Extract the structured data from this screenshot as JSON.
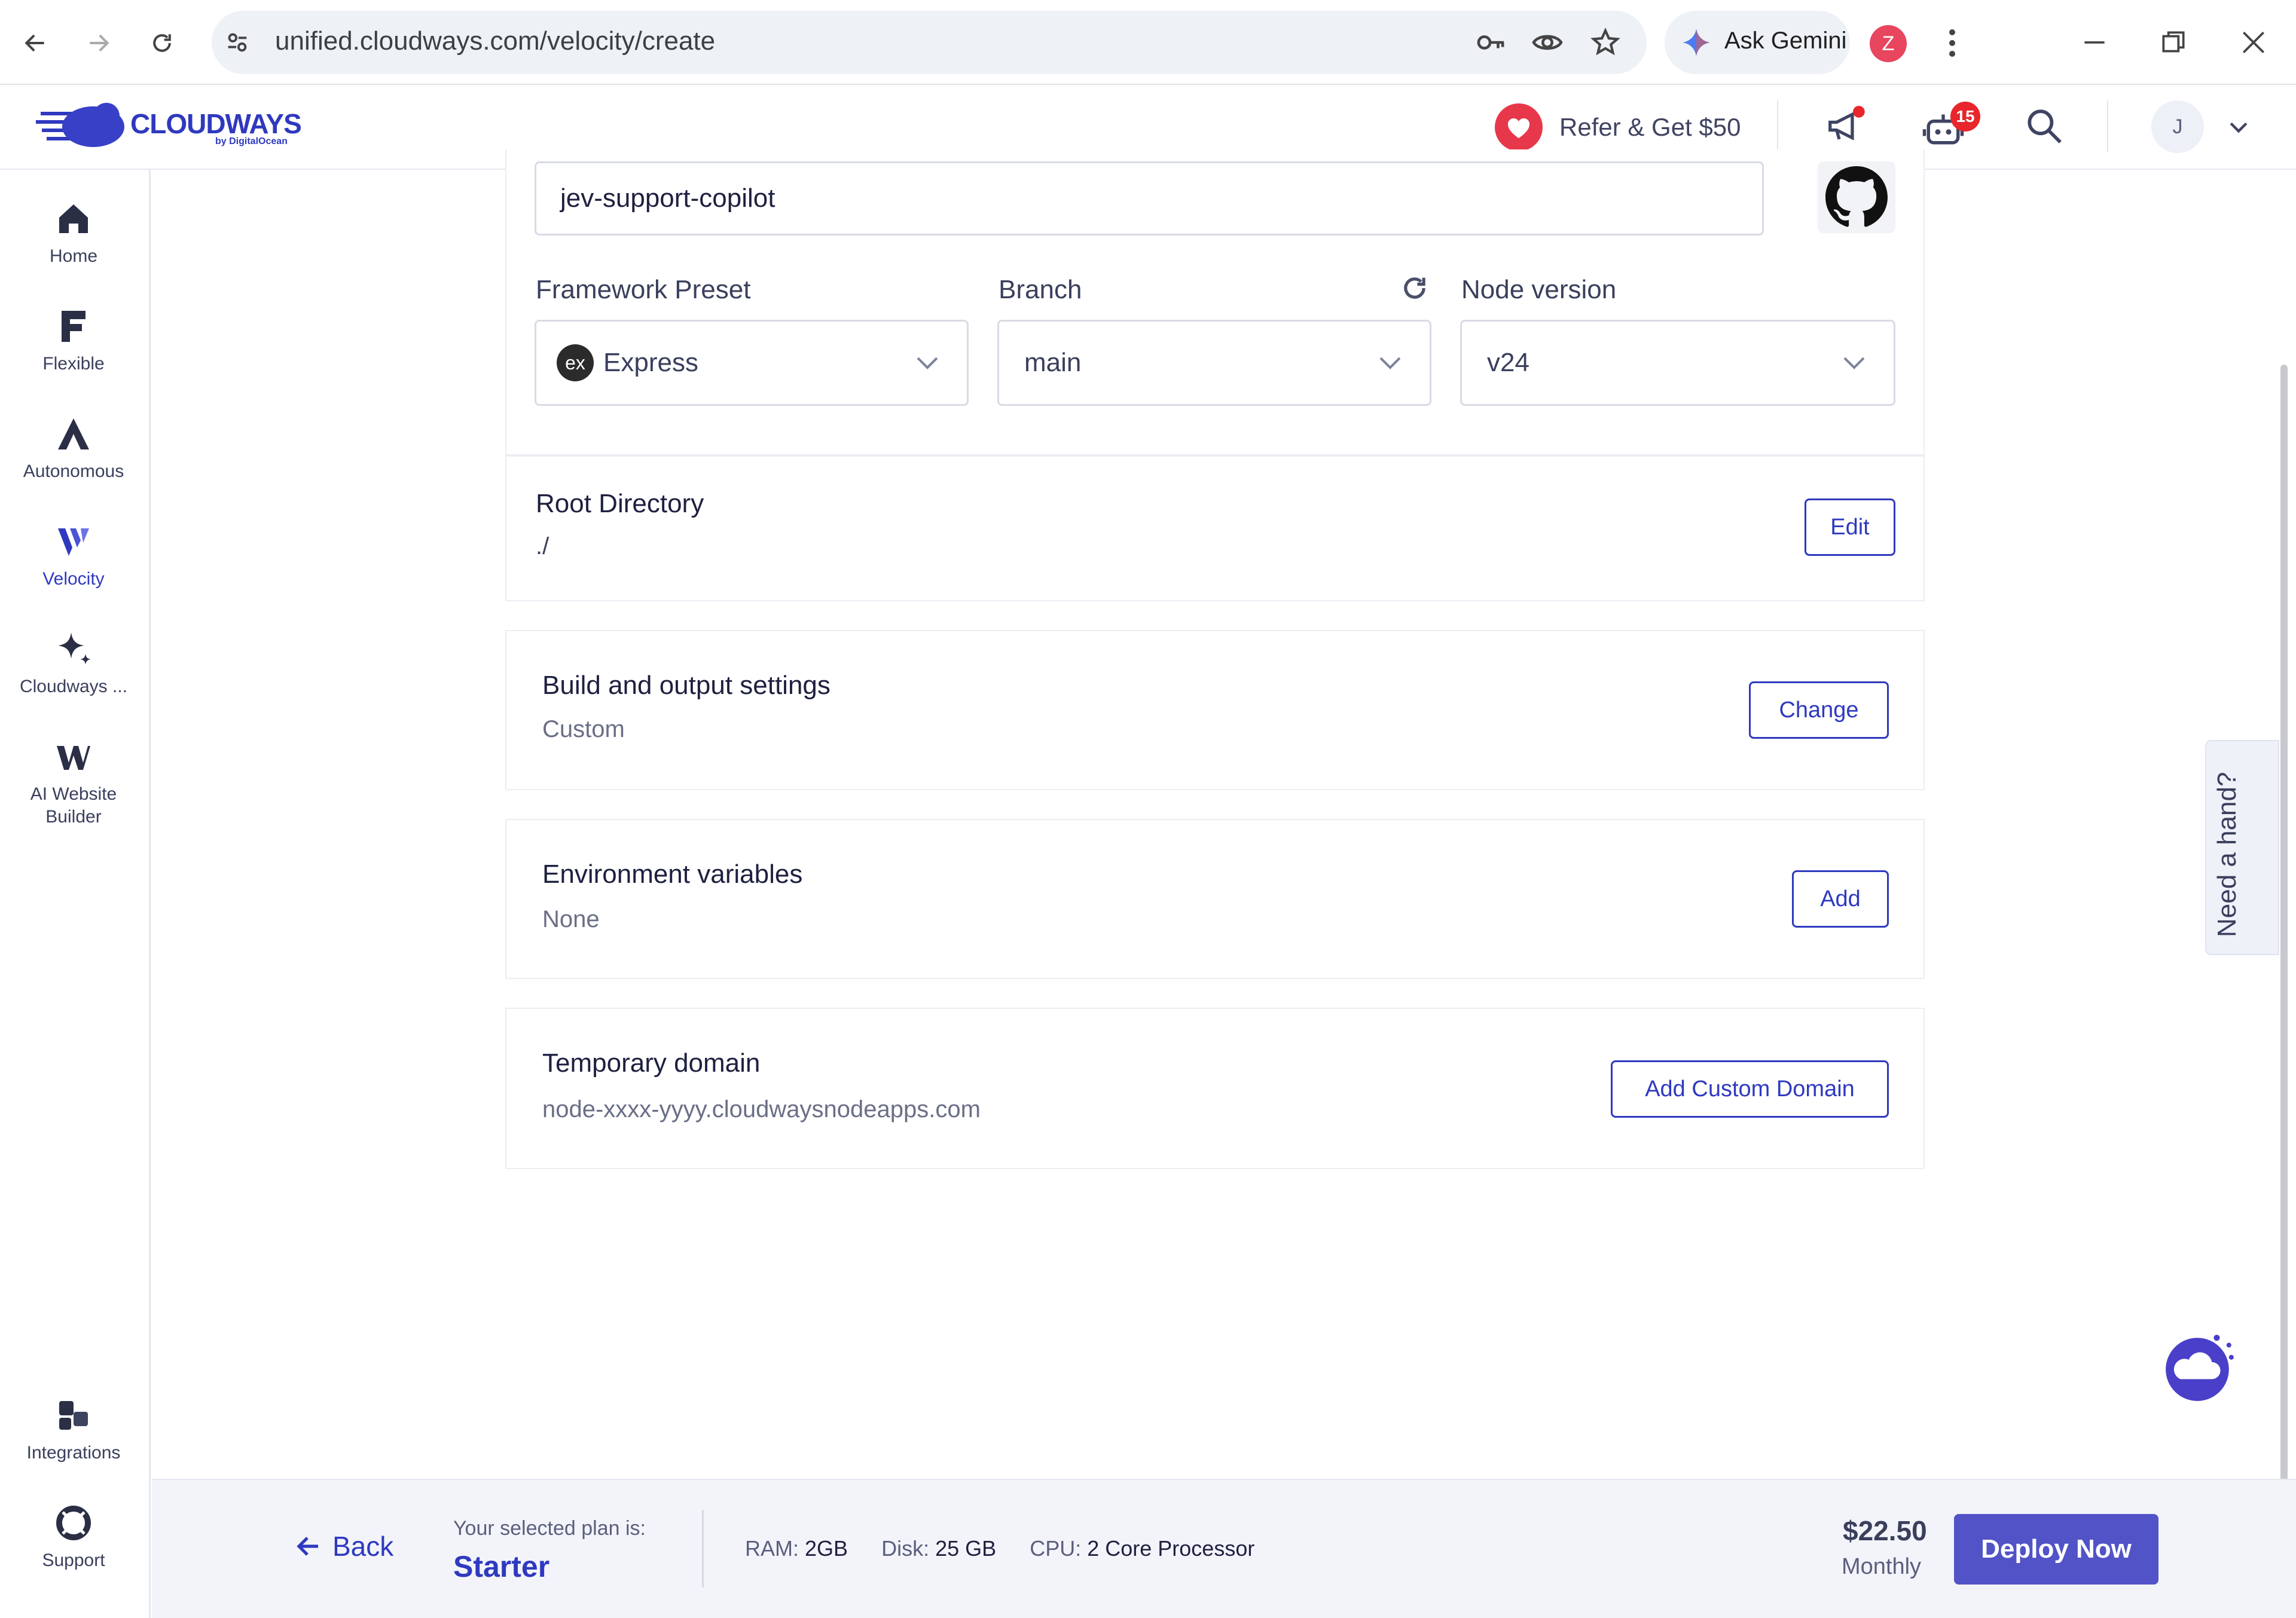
{
  "browser": {
    "url": "unified.cloudways.com/velocity/create",
    "ask_gemini": "Ask Gemini",
    "profile_initial": "Z"
  },
  "header": {
    "logo_text": "CLOUDWAYS",
    "logo_sub": "by DigitalOcean",
    "refer_label": "Refer & Get $50",
    "bot_badge": "15",
    "avatar_initial": "J"
  },
  "sidebar": {
    "items": [
      {
        "label": "Home",
        "icon": "home-icon"
      },
      {
        "label": "Flexible",
        "icon": "flexible-icon"
      },
      {
        "label": "Autonomous",
        "icon": "autonomous-icon"
      },
      {
        "label": "Velocity",
        "icon": "velocity-icon"
      },
      {
        "label": "Cloudways ...",
        "icon": "sparkle-icon"
      },
      {
        "label": "AI Website Builder",
        "icon": "ai-builder-icon"
      }
    ],
    "bottom_items": [
      {
        "label": "Integrations",
        "icon": "integrations-icon"
      },
      {
        "label": "Support",
        "icon": "support-icon"
      }
    ]
  },
  "form": {
    "repo_value": "jev-support-copilot",
    "framework": {
      "label": "Framework Preset",
      "value": "Express",
      "badge": "ex"
    },
    "branch": {
      "label": "Branch",
      "value": "main"
    },
    "node_version": {
      "label": "Node version",
      "value": "v24"
    },
    "root_directory": {
      "title": "Root Directory",
      "value": "./",
      "button": "Edit"
    },
    "build": {
      "title": "Build and output settings",
      "value": "Custom",
      "button": "Change"
    },
    "env": {
      "title": "Environment variables",
      "value": "None",
      "button": "Add"
    },
    "domain": {
      "title": "Temporary domain",
      "value": "node-xxxx-yyyy.cloudwaysnodeapps.com",
      "button": "Add Custom Domain"
    }
  },
  "footer": {
    "back_label": "Back",
    "plan_caption": "Your selected plan is:",
    "plan_name": "Starter",
    "ram_label": "RAM:",
    "ram_value": "2GB",
    "disk_label": "Disk:",
    "disk_value": "25 GB",
    "cpu_label": "CPU:",
    "cpu_value": "2 Core Processor",
    "price": "$22.50",
    "period": "Monthly",
    "deploy_label": "Deploy Now"
  },
  "help_tab": "Need a hand?",
  "colors": {
    "accent": "#2f39bf",
    "deploy": "#5153c7",
    "badge": "#e8262b"
  }
}
